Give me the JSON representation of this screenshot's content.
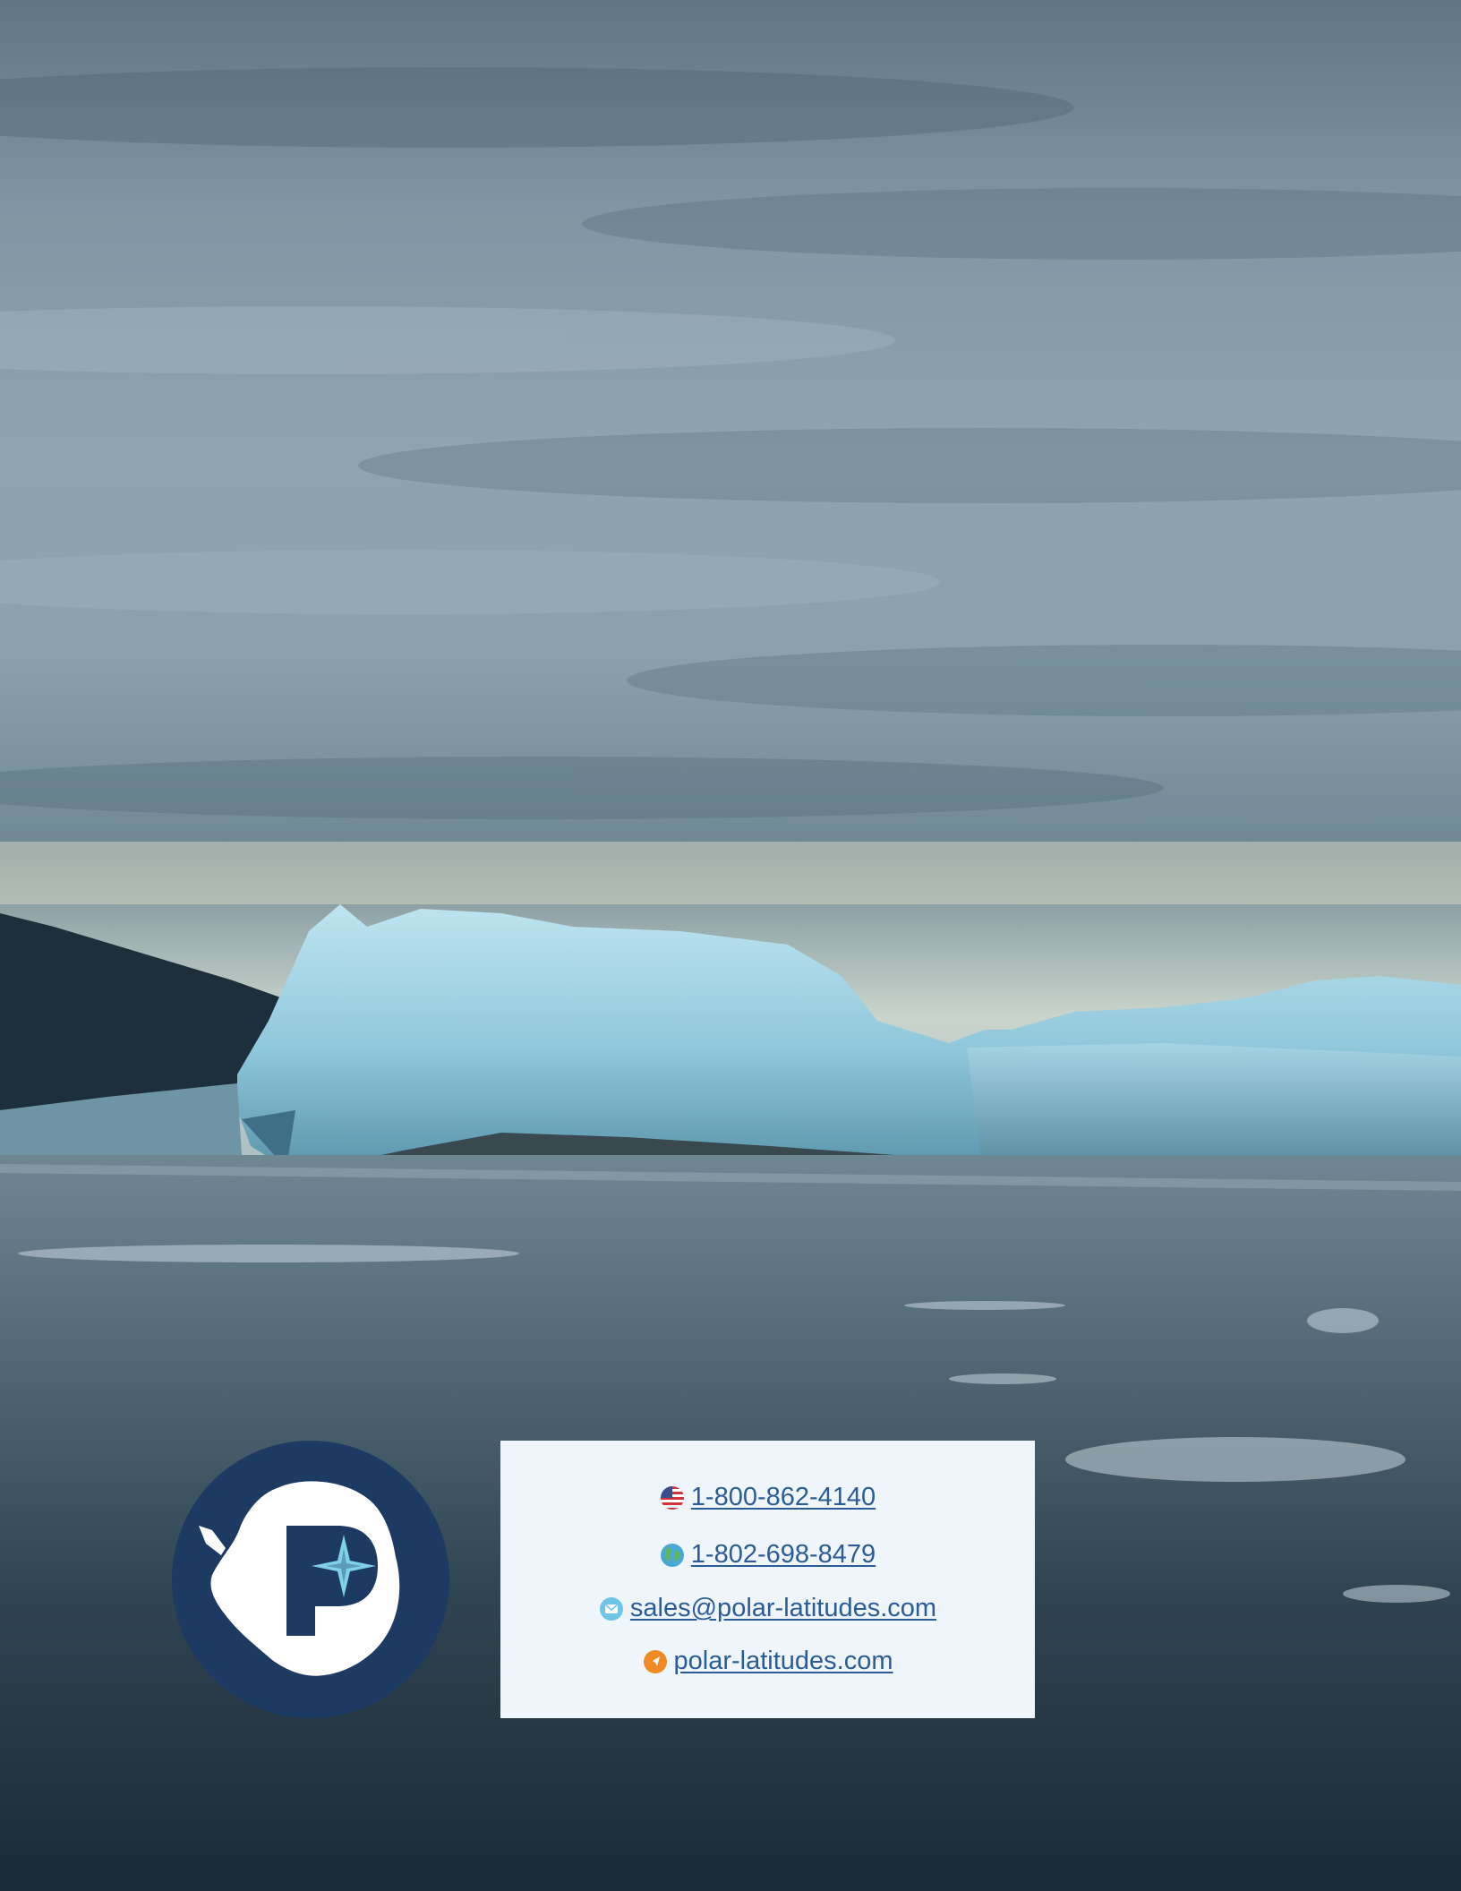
{
  "colors": {
    "logo_navy": "#1d3a63",
    "card_background": "#eef6fb",
    "link_text": "#2c5c97",
    "email_icon": "#6ec6e6",
    "web_icon": "#f08a24"
  },
  "background": {
    "icon": "arctic-iceberg-photo"
  },
  "logo": {
    "icon": "polar-latitudes-antarctica-logo"
  },
  "contact": {
    "us_phone": {
      "icon": "us-flag-icon",
      "text": "1-800-862-4140"
    },
    "intl_phone": {
      "icon": "globe-icon",
      "text": "1-802-698-8479"
    },
    "email": {
      "icon": "envelope-icon",
      "text": "sales@polar-latitudes.com"
    },
    "website": {
      "icon": "compass-icon",
      "text": "polar-latitudes.com"
    }
  }
}
